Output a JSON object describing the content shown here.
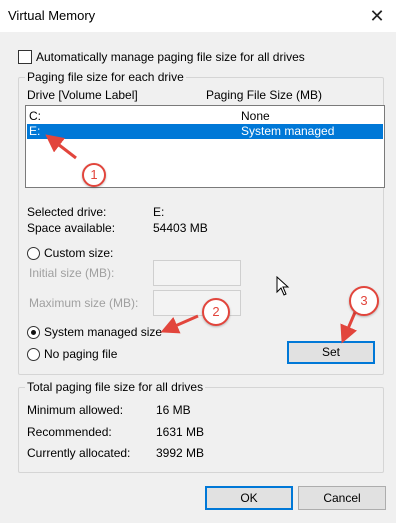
{
  "window": {
    "title": "Virtual Memory",
    "close_glyph": "✕"
  },
  "auto_manage": {
    "label": "Automatically manage paging file size for all drives",
    "checked": false
  },
  "paging_group": {
    "legend": "Paging file size for each drive",
    "columns": {
      "drive": "Drive  [Volume Label]",
      "size": "Paging File Size (MB)"
    },
    "drives": [
      {
        "drive": "C:",
        "size": "None"
      },
      {
        "drive": "E:",
        "size": "System managed",
        "selected": true
      }
    ],
    "selected_drive": {
      "label": "Selected drive:",
      "value": "E:"
    },
    "space_available": {
      "label": "Space available:",
      "value": "54403 MB"
    },
    "custom_size": {
      "label": "Custom size:"
    },
    "initial_size": {
      "label": "Initial size (MB):",
      "value": ""
    },
    "maximum_size": {
      "label": "Maximum size (MB):",
      "value": ""
    },
    "system_managed": {
      "label": "System managed size",
      "checked": true
    },
    "no_paging": {
      "label": "No paging file"
    },
    "set_button": "Set"
  },
  "total_group": {
    "legend": "Total paging file size for all drives",
    "rows": [
      {
        "label": "Minimum allowed:",
        "value": "16 MB"
      },
      {
        "label": "Recommended:",
        "value": "1631 MB"
      },
      {
        "label": "Currently allocated:",
        "value": "3992 MB"
      }
    ]
  },
  "buttons": {
    "ok": "OK",
    "cancel": "Cancel"
  },
  "annotations": [
    "1",
    "2",
    "3"
  ],
  "colors": {
    "selection": "#0078d7",
    "annotation": "#e2453c"
  }
}
